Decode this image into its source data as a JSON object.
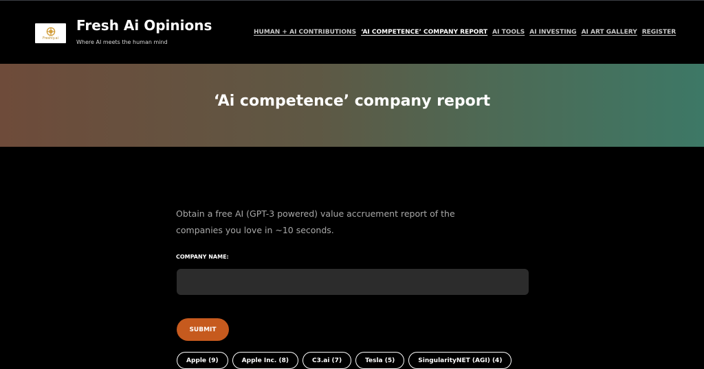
{
  "header": {
    "logo_text": "Freshly.ai",
    "site_title": "Fresh Ai Opinions",
    "tagline": "Where AI meets the human mind",
    "nav": [
      {
        "label": "HUMAN + AI CONTRIBUTIONS"
      },
      {
        "label": "‘AI COMPETENCE’ COMPANY REPORT"
      },
      {
        "label": "AI TOOLS"
      },
      {
        "label": "AI INVESTING"
      },
      {
        "label": "AI ART GALLERY"
      },
      {
        "label": "REGISTER"
      }
    ],
    "active_nav": "‘AI COMPETENCE’ COMPANY REPORT"
  },
  "hero": {
    "title": "‘Ai competence’ company report"
  },
  "form": {
    "intro": "Obtain a free AI (GPT-3 powered) value accruement report of the companies you love in ~10 seconds.",
    "field_label": "COMPANY NAME:",
    "company_value": "",
    "submit_label": "SUBMIT"
  },
  "chips": [
    {
      "label": "Apple (9)"
    },
    {
      "label": "Apple Inc. (8)"
    },
    {
      "label": "C3.ai (7)"
    },
    {
      "label": "Tesla (5)"
    },
    {
      "label": "SingularityNET (AGI) (4)"
    }
  ],
  "colors": {
    "background": "#000000",
    "accent": "#c65a1e",
    "input_bg": "#2c2c2c",
    "hero_start": "#6e4b3a",
    "hero_end": "#3d7866"
  },
  "icons": {
    "logo": "freshly-ai-logo-icon"
  }
}
